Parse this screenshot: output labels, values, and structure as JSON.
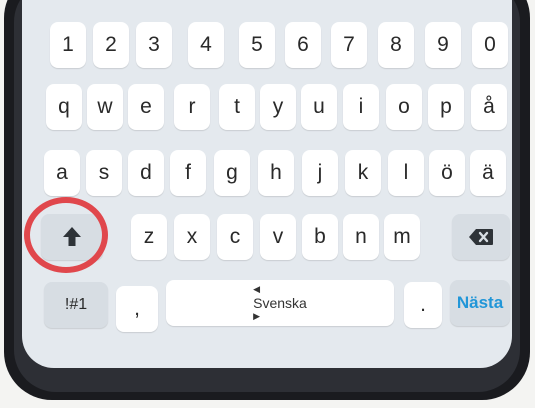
{
  "keyboard": {
    "row1": [
      "1",
      "2",
      "3",
      "4",
      "5",
      "6",
      "7",
      "8",
      "9",
      "0"
    ],
    "row2": [
      "q",
      "w",
      "e",
      "r",
      "t",
      "y",
      "u",
      "i",
      "o",
      "p",
      "å"
    ],
    "row3": [
      "a",
      "s",
      "d",
      "f",
      "g",
      "h",
      "j",
      "k",
      "l",
      "ö",
      "ä"
    ],
    "row4": [
      "z",
      "x",
      "c",
      "v",
      "b",
      "n",
      "m"
    ],
    "symbols_label": "!#1",
    "comma_label": ",",
    "space_label": "Svenska",
    "period_label": ".",
    "next_label": "Nästa",
    "shift_icon": "shift-arrow-icon",
    "backspace_icon": "backspace-icon",
    "highlight_color": "#e0474c",
    "accent_color": "#2196d8"
  }
}
